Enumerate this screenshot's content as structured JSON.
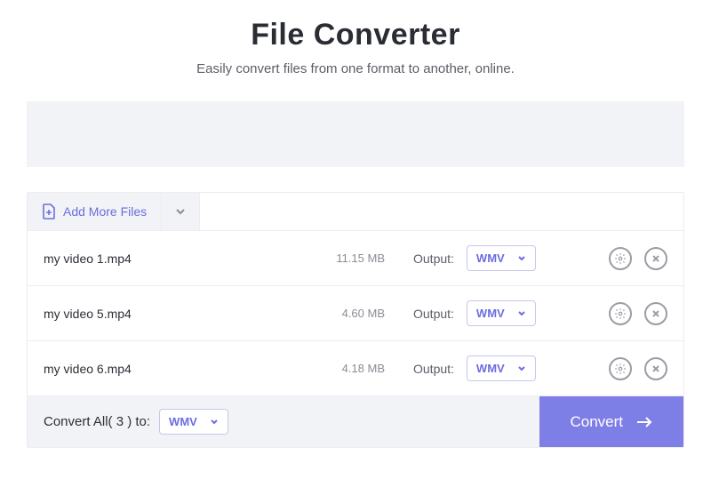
{
  "header": {
    "title": "File Converter",
    "subtitle": "Easily convert files from one format to another, online."
  },
  "toolbar": {
    "add_more_label": "Add More Files"
  },
  "files": [
    {
      "name": "my video 1.mp4",
      "size": "11.15 MB",
      "output_label": "Output:",
      "format": "WMV"
    },
    {
      "name": "my video 5.mp4",
      "size": "4.60 MB",
      "output_label": "Output:",
      "format": "WMV"
    },
    {
      "name": "my video 6.mp4",
      "size": "4.18 MB",
      "output_label": "Output:",
      "format": "WMV"
    }
  ],
  "footer": {
    "convert_all_label": "Convert All( 3 ) to:",
    "convert_all_format": "WMV",
    "convert_button_label": "Convert"
  }
}
